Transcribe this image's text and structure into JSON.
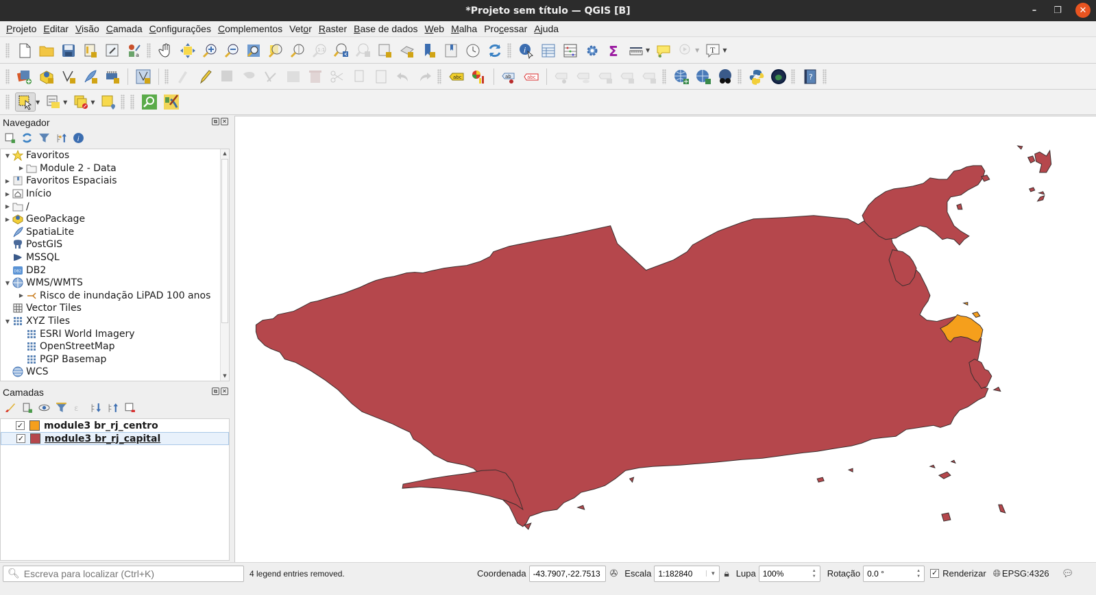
{
  "window": {
    "title": "*Projeto sem título — QGIS [B]",
    "minimize_label": "–",
    "maximize_label": "❐",
    "close_label": "✕"
  },
  "menubar": {
    "items": [
      {
        "label": "Projeto",
        "mnemonic": "P"
      },
      {
        "label": "Editar",
        "mnemonic": "E"
      },
      {
        "label": "Visão",
        "mnemonic": "V"
      },
      {
        "label": "Camada",
        "mnemonic": "C"
      },
      {
        "label": "Configurações",
        "mnemonic": "C"
      },
      {
        "label": "Complementos",
        "mnemonic": "C"
      },
      {
        "label": "Vetor",
        "mnemonic": "o"
      },
      {
        "label": "Raster",
        "mnemonic": "R"
      },
      {
        "label": "Base de dados",
        "mnemonic": "B"
      },
      {
        "label": "Web",
        "mnemonic": "W"
      },
      {
        "label": "Malha",
        "mnemonic": "M"
      },
      {
        "label": "Processar",
        "mnemonic": "c"
      },
      {
        "label": "Ajuda",
        "mnemonic": "A"
      }
    ]
  },
  "navigator": {
    "title": "Navegador",
    "tools": [
      "add-selected-icon",
      "refresh-icon",
      "filter-icon",
      "collapse-all-icon",
      "info-icon"
    ],
    "items": [
      {
        "label": "Favoritos",
        "level": 0,
        "expander": "expanded",
        "icon": "star-icon"
      },
      {
        "label": "Module 2 - Data",
        "level": 1,
        "expander": "collapsed",
        "icon": "folder-icon"
      },
      {
        "label": "Favoritos Espaciais",
        "level": 0,
        "expander": "collapsed",
        "icon": "spatial-bookmark-icon"
      },
      {
        "label": "Início",
        "level": 0,
        "expander": "collapsed",
        "icon": "home-folder-icon"
      },
      {
        "label": "/",
        "level": 0,
        "expander": "collapsed",
        "icon": "folder-icon"
      },
      {
        "label": "GeoPackage",
        "level": 0,
        "expander": "collapsed",
        "icon": "geopackage-icon"
      },
      {
        "label": "SpatiaLite",
        "level": 0,
        "expander": "none",
        "icon": "spatialite-icon"
      },
      {
        "label": "PostGIS",
        "level": 0,
        "expander": "none",
        "icon": "postgis-icon"
      },
      {
        "label": "MSSQL",
        "level": 0,
        "expander": "none",
        "icon": "mssql-icon"
      },
      {
        "label": "DB2",
        "level": 0,
        "expander": "none",
        "icon": "db2-icon"
      },
      {
        "label": "WMS/WMTS",
        "level": 0,
        "expander": "expanded",
        "icon": "wms-icon"
      },
      {
        "label": "Risco de inundação LiPAD 100 anos",
        "level": 1,
        "expander": "collapsed",
        "icon": "wms-connection-icon"
      },
      {
        "label": "Vector Tiles",
        "level": 0,
        "expander": "none",
        "icon": "vector-tiles-icon"
      },
      {
        "label": "XYZ Tiles",
        "level": 0,
        "expander": "expanded",
        "icon": "xyz-tiles-icon"
      },
      {
        "label": "ESRI World Imagery",
        "level": 1,
        "expander": "none",
        "icon": "xyz-tile-icon"
      },
      {
        "label": "OpenStreetMap",
        "level": 1,
        "expander": "none",
        "icon": "xyz-tile-icon"
      },
      {
        "label": "PGP Basemap",
        "level": 1,
        "expander": "none",
        "icon": "xyz-tile-icon"
      },
      {
        "label": "WCS",
        "level": 0,
        "expander": "none",
        "icon": "wcs-icon"
      }
    ]
  },
  "layers": {
    "title": "Camadas",
    "tools": [
      "style-icon",
      "add-group-icon",
      "visibility-icon",
      "filter-legend-icon",
      "expression-filter-icon",
      "expand-all-icon",
      "collapse-all-icon",
      "remove-layer-icon"
    ],
    "items": [
      {
        "name": "module3 br_rj_centro",
        "checked": true,
        "color": "#f59f1c",
        "selected": false
      },
      {
        "name": "module3 br_rj_capital",
        "checked": true,
        "color": "#b5474c",
        "selected": true
      }
    ]
  },
  "map": {
    "capital_color": "#b5474c",
    "centro_color": "#f59f1c",
    "outline_color": "#3a2f2f",
    "background": "#ffffff"
  },
  "statusbar": {
    "locator_placeholder": "Escreva para localizar (Ctrl+K)",
    "message": "4 legend entries removed.",
    "coordinate_label": "Coordenada",
    "coordinate_value": "-43.7907,-22.7513",
    "scale_label": "Escala",
    "scale_value": "1:182840",
    "magnifier_label": "Lupa",
    "magnifier_value": "100%",
    "rotation_label": "Rotação",
    "rotation_value": "0.0 °",
    "render_label": "Renderizar",
    "render_checked": true,
    "crs_label": "EPSG:4326"
  }
}
